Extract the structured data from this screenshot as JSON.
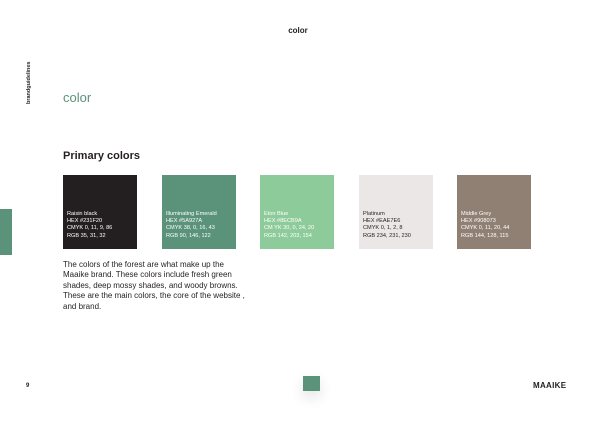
{
  "header": {
    "title": "color"
  },
  "sidebar": {
    "label": "brandguidelines"
  },
  "section": {
    "title": "color"
  },
  "primary": {
    "heading": "Primary colors",
    "swatches": [
      {
        "name": "Raisin black",
        "hex": "HEX #231F20",
        "cmyk": "CMYK 0, 11, 9, 86",
        "rgb": "RGB 35, 31, 32",
        "color": "#231F20",
        "text_color": "#FFFFFF"
      },
      {
        "name": "Illuminating Emerald",
        "hex": "HEX #5A927A",
        "cmyk": "CMYK 38, 0, 16, 43",
        "rgb": "RGB 90, 146, 122",
        "color": "#5A927A",
        "text_color": "#FFFFFF"
      },
      {
        "name": "Eton Blue",
        "hex": "HEX #8ECB9A",
        "cmyk": "CM YK 30, 0, 24, 20",
        "rgb": "RGB 142, 203, 154",
        "color": "#8ECB9A",
        "text_color": "#FFFFFF"
      },
      {
        "name": "Platinum",
        "hex": "HEX #EAE7E6",
        "cmyk": "CMYK 0, 1, 2, 8",
        "rgb": "RGB 234, 231, 230",
        "color": "#EAE7E6",
        "text_color": "#231F20"
      },
      {
        "name": "Middle Grey",
        "hex": "HEX #908073",
        "cmyk": "CMYK 0, 11, 20, 44",
        "rgb": "RGB 144, 128, 115",
        "color": "#908073",
        "text_color": "#FFFFFF"
      }
    ],
    "description": "The colors of the forest are what make up the Maaike brand. These colors include fresh green shades, deep mossy shades, and woody browns. These are the main colors, the core of the website , and brand."
  },
  "footer": {
    "page_number": "9",
    "logo": "MAAIKE",
    "accent_color": "#5A927A"
  }
}
